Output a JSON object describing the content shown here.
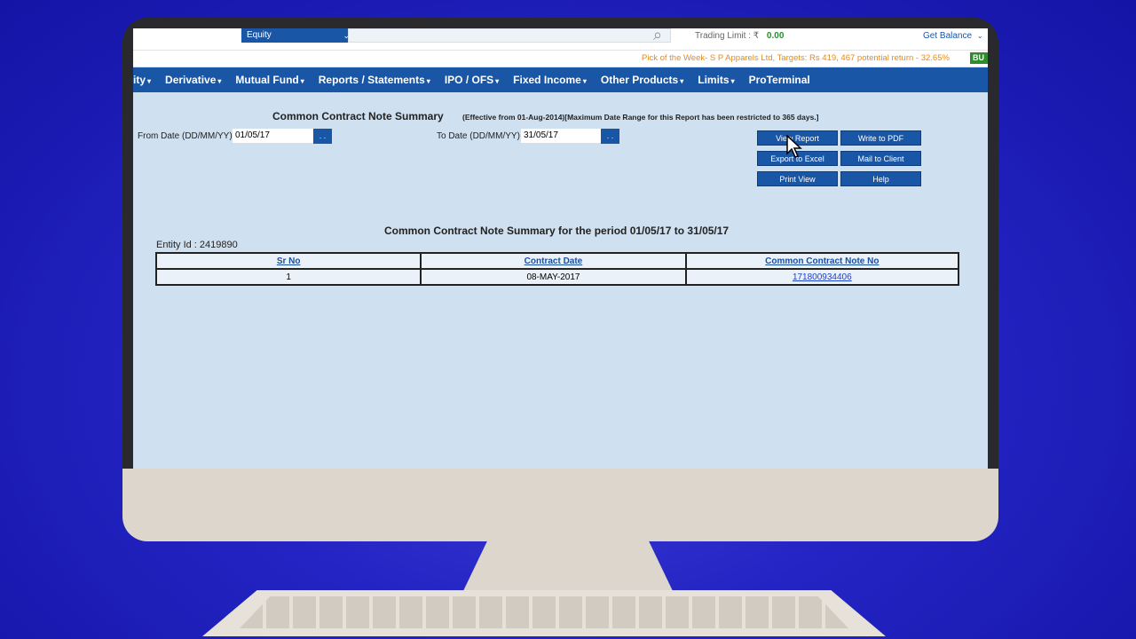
{
  "topbar": {
    "segment_select": "Equity",
    "trading_limit_label": "Trading Limit :",
    "currency_symbol": "₹",
    "trading_limit_value": "0.00",
    "get_balance": "Get Balance"
  },
  "ticker": {
    "text": "Pick of the Week- S P Apparels Ltd, Targets: Rs 419, 467 potential return - 32.65%",
    "badge": "BU"
  },
  "nav": {
    "items": [
      "ity",
      "Derivative",
      "Mutual Fund",
      "Reports / Statements",
      "IPO / OFS",
      "Fixed Income",
      "Other Products",
      "Limits",
      "ProTerminal"
    ]
  },
  "report": {
    "title": "Common Contract Note Summary",
    "note": "(Effective from 01-Aug-2014)[Maximum Date Range for this Report has been restricted to 365 days.]",
    "from_label": "From Date (DD/MM/YY)",
    "from_value": "01/05/17",
    "to_label": "To Date (DD/MM/YY)",
    "to_value": "31/05/17",
    "picker_label": ". .",
    "buttons": {
      "view_report": "View Report",
      "write_pdf": "Write to PDF",
      "export_excel": "Export to Excel",
      "mail_client": "Mail to Client",
      "print_view": "Print View",
      "help": "Help"
    },
    "period_title": "Common Contract Note Summary for the period 01/05/17 to 31/05/17",
    "entity": "Entity Id : 2419890",
    "columns": [
      "Sr No",
      "Contract Date",
      "Common Contract Note No"
    ],
    "rows": [
      {
        "sr": "1",
        "date": "08-MAY-2017",
        "note_no": "171800934406"
      }
    ]
  },
  "colors": {
    "nav_bg": "#1a56a6",
    "screen_bg": "#cfe0f0",
    "background": "#2424c4"
  }
}
